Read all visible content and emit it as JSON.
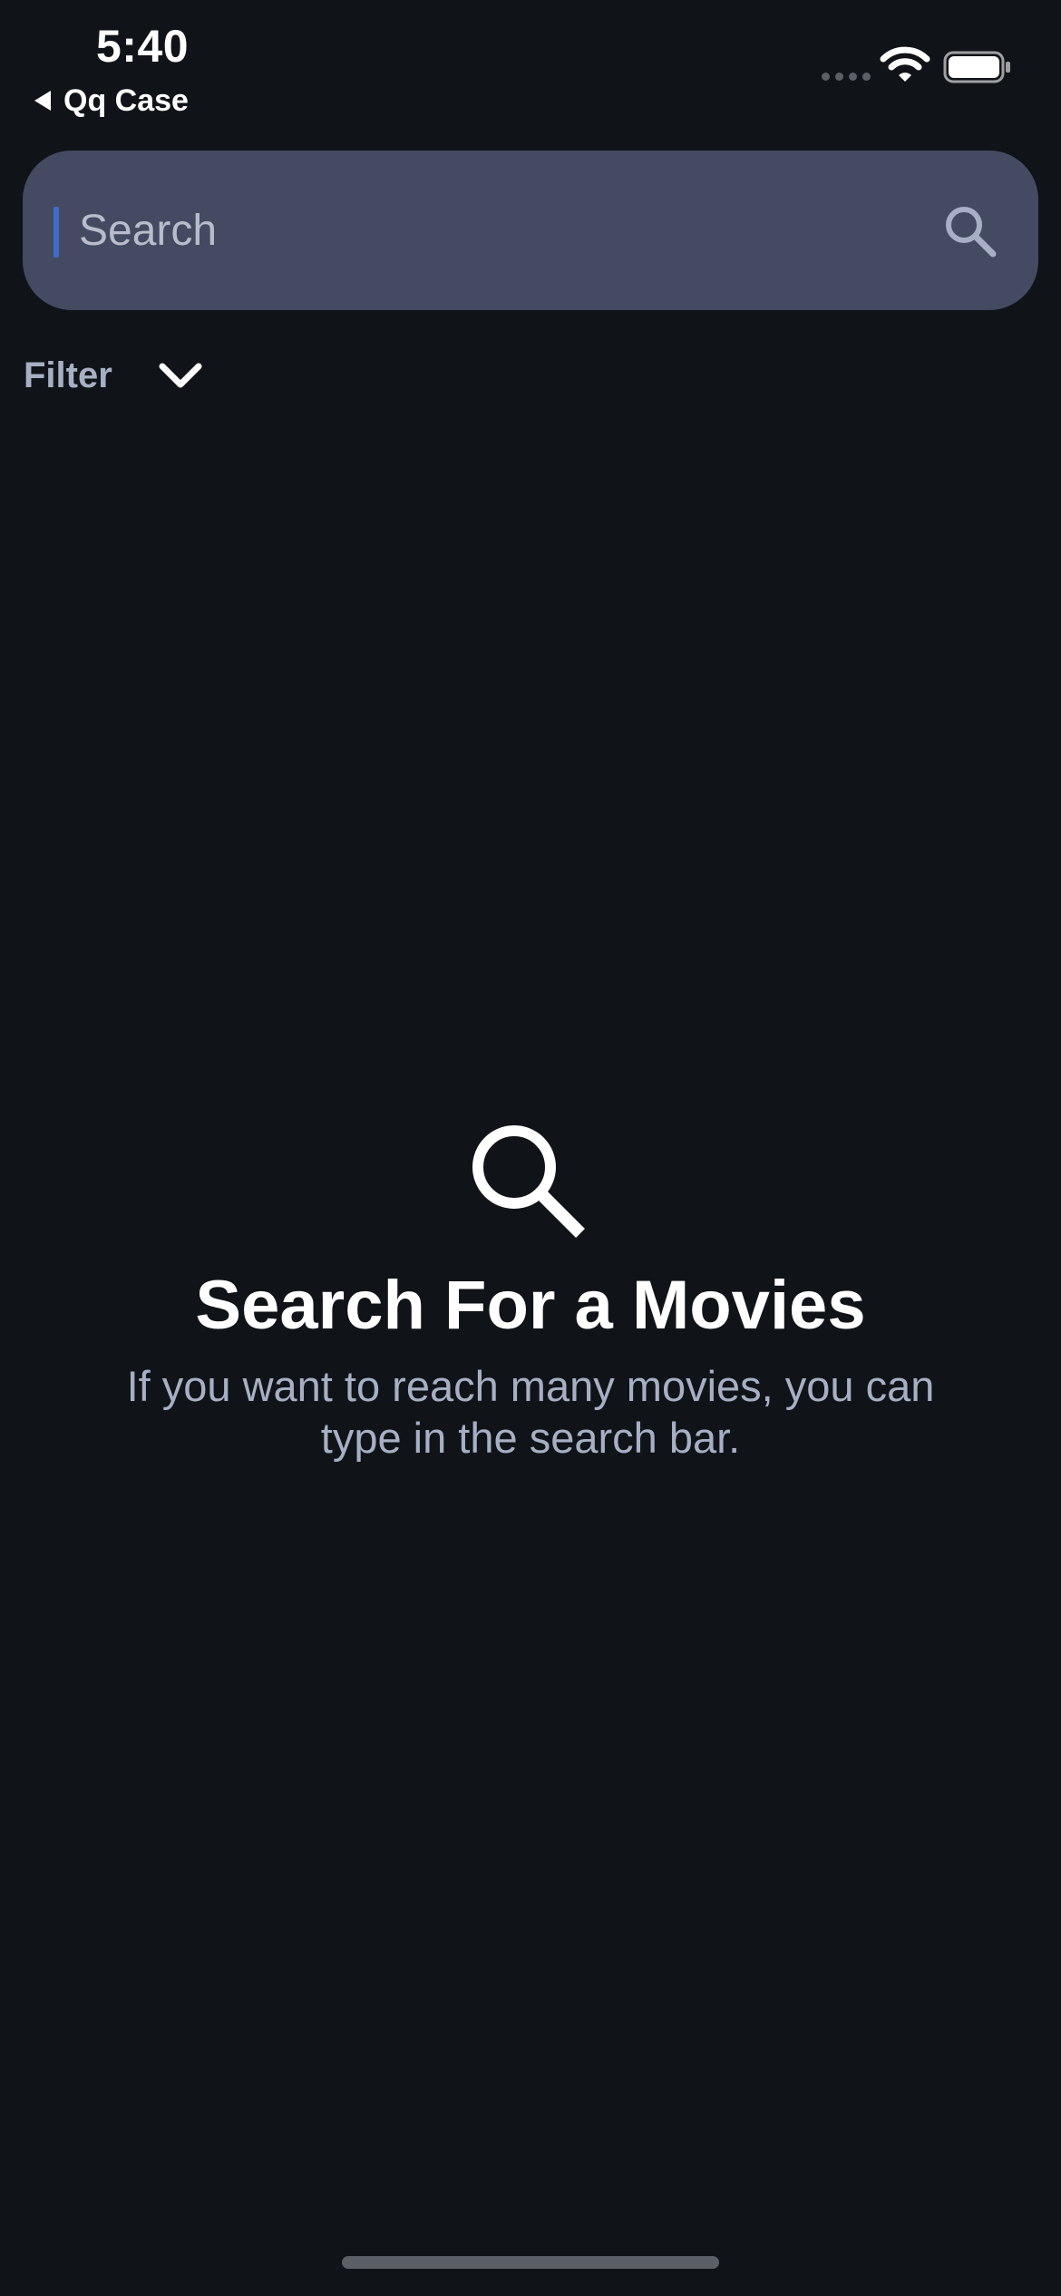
{
  "status_bar": {
    "time": "5:40",
    "back_label": "Qq Case",
    "icons": [
      "signal-dots-icon",
      "wifi-icon",
      "battery-icon"
    ]
  },
  "search": {
    "placeholder": "Search",
    "value": "",
    "icon": "search-icon"
  },
  "filter": {
    "label": "Filter",
    "icon": "chevron-down-icon"
  },
  "empty_state": {
    "icon": "search-icon",
    "title": "Search For a Movies",
    "subtitle": "If you want to reach many movies, you can type in the search bar."
  },
  "colors": {
    "background": "#101318",
    "search_bar": "#434a61",
    "secondary_text": "#a7afc4",
    "caret": "#3f6cc8"
  }
}
